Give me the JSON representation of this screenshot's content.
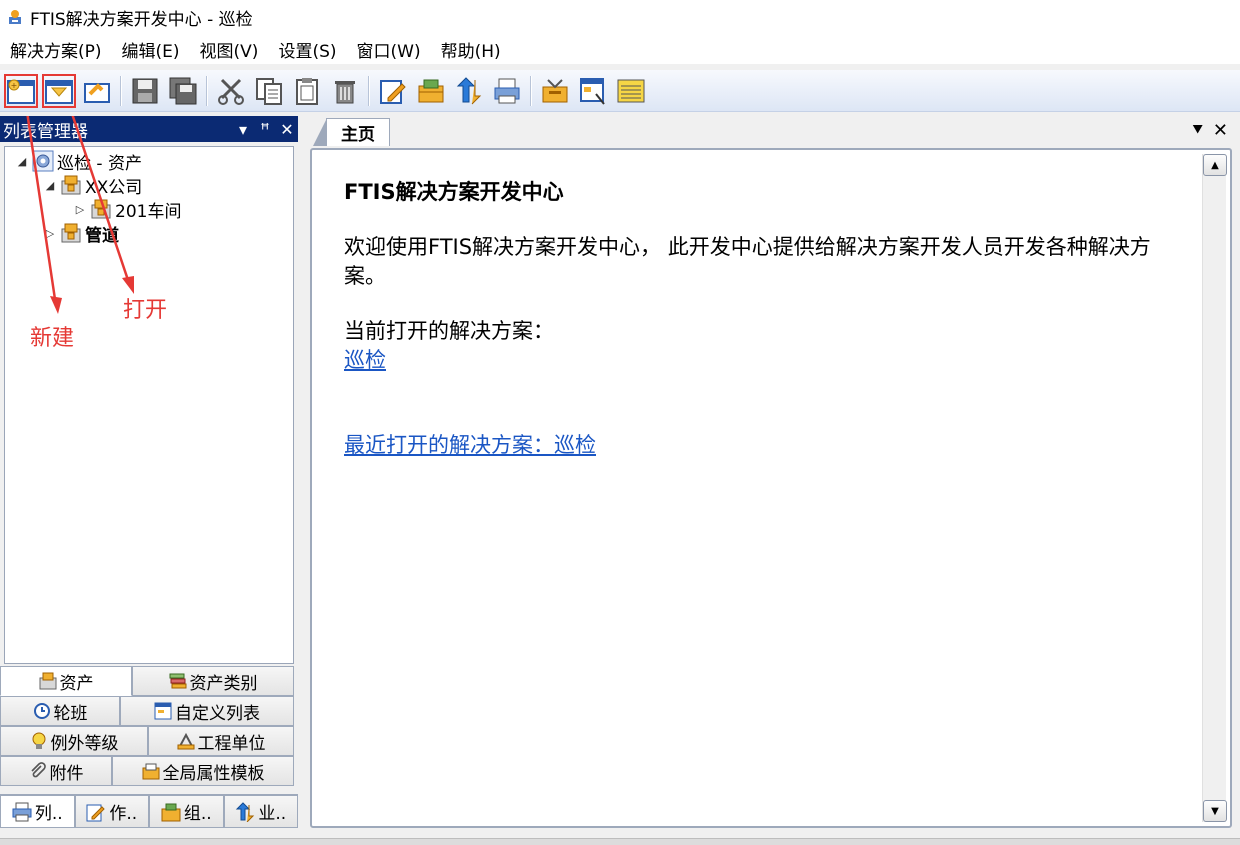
{
  "window": {
    "title": "FTIS解决方案开发中心 - 巡检"
  },
  "menu": [
    "解决方案(P)",
    "编辑(E)",
    "视图(V)",
    "设置(S)",
    "窗口(W)",
    "帮助(H)"
  ],
  "toolbar": {
    "icons": [
      "new-solution-icon",
      "open-solution-icon",
      "open-folder-icon",
      "save-icon",
      "save-all-icon",
      "cut-icon",
      "copy-icon",
      "paste-icon",
      "delete-icon",
      "edit-icon",
      "package-icon",
      "publish-icon",
      "print-icon",
      "film-icon",
      "window-icon",
      "notes-icon"
    ]
  },
  "leftpanel": {
    "title": "列表管理器",
    "controls": {
      "dropdown": "▾",
      "pin": "ꟸ",
      "close": "✕"
    },
    "tree": [
      {
        "label": "巡检 - 资产",
        "toggle": "◢",
        "bold": false
      },
      {
        "label": "XX公司",
        "toggle": "◢",
        "bold": false
      },
      {
        "label": "201车间",
        "toggle": "▷",
        "bold": false
      },
      {
        "label": "管道",
        "toggle": "▷",
        "bold": true
      }
    ],
    "annotations": {
      "new": "新建",
      "open": "打开"
    },
    "tabs": [
      [
        "资产",
        "资产类别"
      ],
      [
        "轮班",
        "自定义列表"
      ],
      [
        "例外等级",
        "工程单位"
      ],
      [
        "附件",
        "全局属性模板"
      ]
    ],
    "bottom_tabs": [
      "列..",
      "作..",
      "组..",
      "业.."
    ]
  },
  "doc": {
    "tab": "主页",
    "controls": {
      "menu": "⯆",
      "close": "✕"
    },
    "heading": "FTIS解决方案开发中心",
    "welcome": "欢迎使用FTIS解决方案开发中心， 此开发中心提供给解决方案开发人员开发各种解决方案。",
    "current_label": "当前打开的解决方案：",
    "current_link": "巡检",
    "recent_link": "最近打开的解决方案：巡检",
    "scroll_up": "▲",
    "scroll_down": "▼"
  },
  "colors": {
    "panel_header": "#0b2a73",
    "link": "#1a56c4",
    "annotation": "#e53935"
  }
}
